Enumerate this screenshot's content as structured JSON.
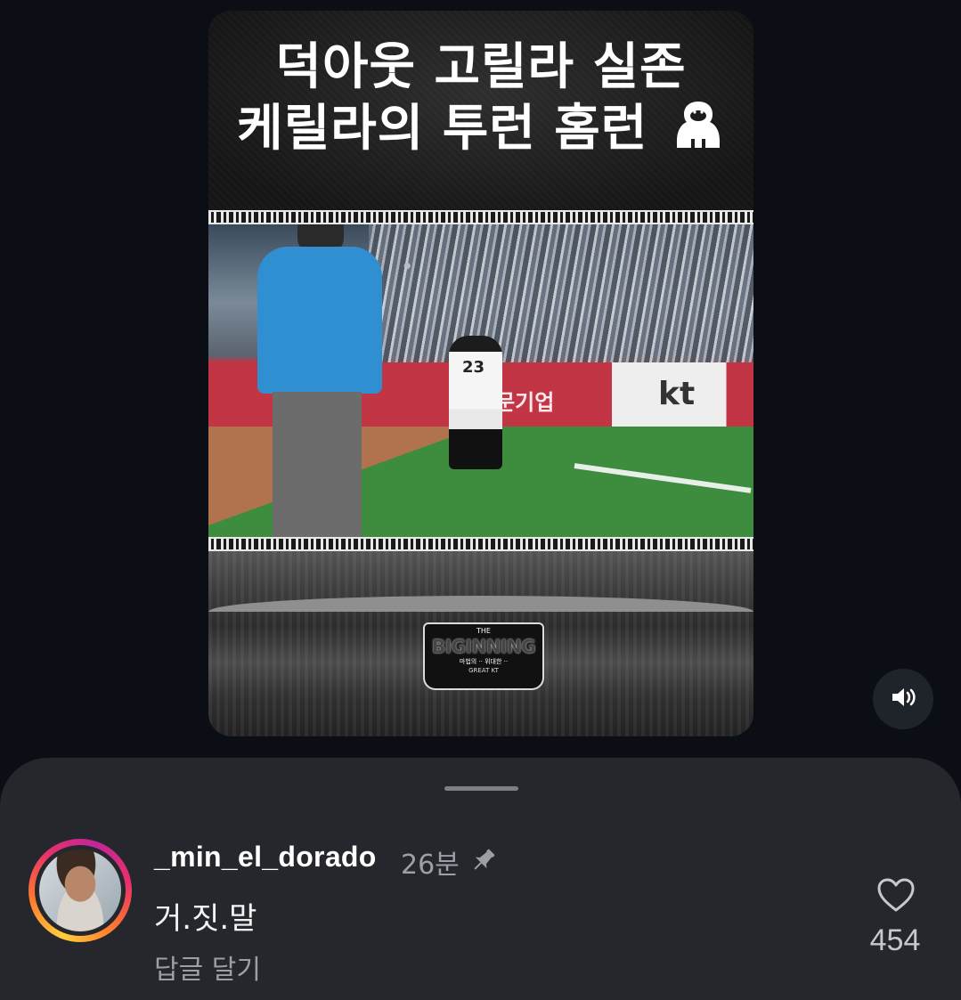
{
  "video": {
    "headline_line1": "덕아웃 고릴라 실존",
    "headline_line2": "케릴라의 투런 홈런",
    "headline_emoji_icon": "gorilla-icon",
    "in_video_ad_text": "전문기업",
    "in_video_brand": "kt",
    "player_number": "23",
    "logo": {
      "the": "THE",
      "word": "BIGINNING",
      "tagline": "마법의 ·· 위대한 ··",
      "sub": "GREAT KT"
    }
  },
  "controls": {
    "sound_icon": "speaker-on-icon"
  },
  "comment": {
    "username": "_min_el_dorado",
    "time": "26분",
    "pinned_icon": "pin-icon",
    "text": "거.짓.말",
    "reply_label": "답글 달기",
    "like_icon": "heart-outline-icon",
    "like_count": "454"
  },
  "colors": {
    "background": "#0b0f15",
    "sheet": "#25272c",
    "secondary_text": "#9c9fa6"
  }
}
